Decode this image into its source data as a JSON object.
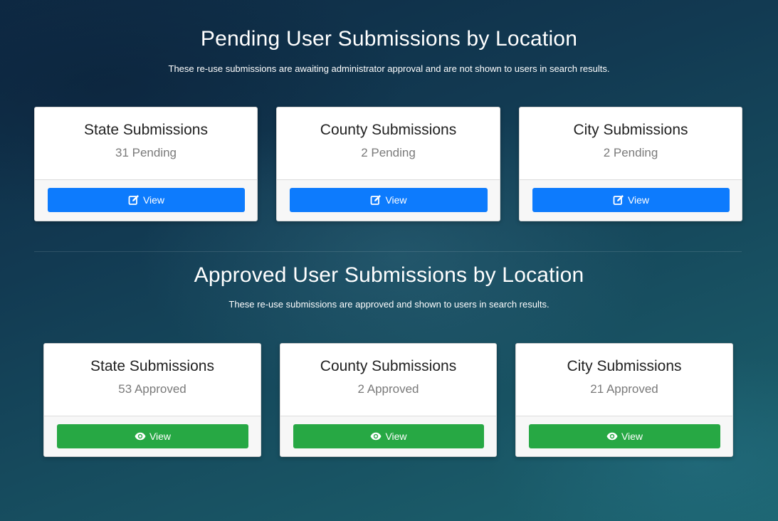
{
  "pending": {
    "title": "Pending User Submissions by Location",
    "description": "These re-use submissions are awaiting administrator approval and are not shown to users in search results.",
    "button_color": "#0d7bfd",
    "button_icon": "edit-icon",
    "cards": [
      {
        "title": "State Submissions",
        "count": "31 Pending",
        "button_label": "View"
      },
      {
        "title": "County Submissions",
        "count": "2 Pending",
        "button_label": "View"
      },
      {
        "title": "City Submissions",
        "count": "2 Pending",
        "button_label": "View"
      }
    ]
  },
  "approved": {
    "title": "Approved User Submissions by Location",
    "description": "These re-use submissions are approved and shown to users in search results.",
    "button_color": "#27a844",
    "button_icon": "eye-icon",
    "cards": [
      {
        "title": "State Submissions",
        "count": "53 Approved",
        "button_label": "View"
      },
      {
        "title": "County Submissions",
        "count": "2 Approved",
        "button_label": "View"
      },
      {
        "title": "City Submissions",
        "count": "21 Approved",
        "button_label": "View"
      }
    ]
  }
}
